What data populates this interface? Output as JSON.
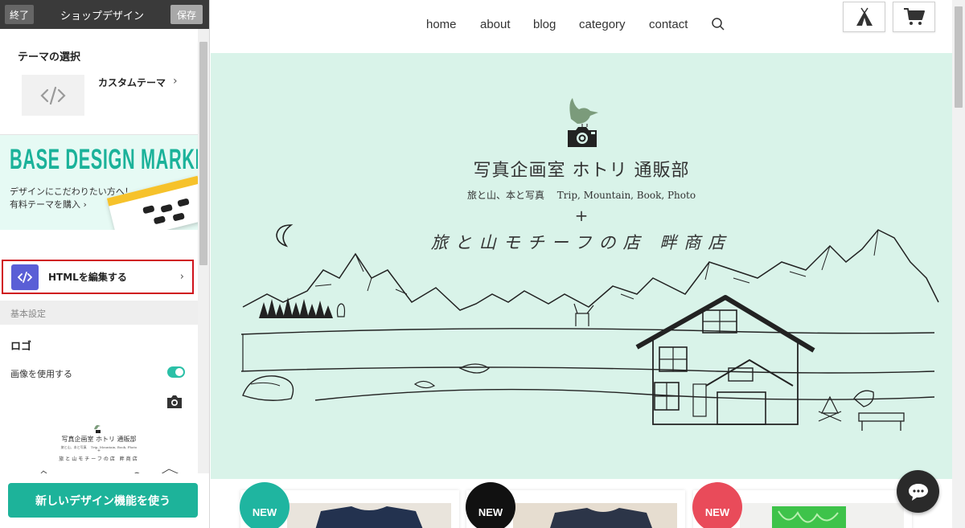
{
  "editor": {
    "end_label": "終了",
    "title": "ショップデザイン",
    "save_label": "保存",
    "theme_heading": "テーマの選択",
    "theme_name": "カスタムテーマ",
    "market": {
      "logo_text": "BASE DESIGN MARKET",
      "line1": "デザインにこだわりたい方へ！",
      "line2": "有料テーマを購入"
    },
    "html_edit_label": "HTMLを編集する",
    "basic_settings": "基本設定",
    "logo_heading": "ロゴ",
    "use_image_label": "画像を使用する",
    "use_image_enabled": true,
    "new_design_button": "新しいデザイン機能を使う"
  },
  "nav": {
    "links": [
      "home",
      "about",
      "blog",
      "category",
      "contact"
    ]
  },
  "hero": {
    "title": "写真企画室 ホトリ 通販部",
    "subtitle": "旅と山、本と写真　 Trip, Mountain, Book, Photo",
    "plus": "+",
    "handwritten": "旅と山モチーフの店 畔商店"
  },
  "products": {
    "badges": [
      {
        "label": "NEW",
        "color": "#1fb5a0"
      },
      {
        "label": "NEW",
        "color": "#111111"
      },
      {
        "label": "NEW",
        "color": "#e94b5a"
      }
    ]
  },
  "colors": {
    "accent": "#1db39a",
    "hero_bg": "#d9f3e9",
    "highlight_border": "#d0121b",
    "html_icon_bg": "#5a5fd6"
  }
}
